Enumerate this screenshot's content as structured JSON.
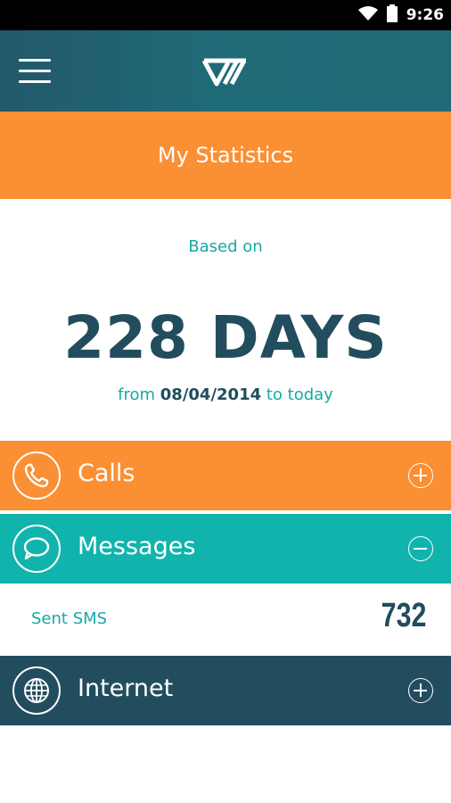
{
  "status_bar": {
    "time": "9:26",
    "icons": [
      "wifi-icon",
      "battery-icon"
    ]
  },
  "app_bar": {
    "menu_icon": "hamburger-menu-icon",
    "logo_icon": "app-logo-icon"
  },
  "banner": {
    "title": "My Statistics"
  },
  "summary": {
    "based_on": "Based on",
    "days": "228 DAYS",
    "range_prefix": "from ",
    "range_date": "08/04/2014",
    "range_suffix": " to today"
  },
  "sections": {
    "calls": {
      "label": "Calls",
      "icon": "phone-icon",
      "toggle": "expand-plus-icon",
      "expanded": false
    },
    "messages": {
      "label": "Messages",
      "icon": "chat-bubble-icon",
      "toggle": "collapse-minus-icon",
      "expanded": true
    },
    "internet": {
      "label": "Internet",
      "icon": "globe-icon",
      "toggle": "expand-plus-icon",
      "expanded": false
    }
  },
  "messages_detail": {
    "sent_sms_label": "Sent SMS",
    "sent_sms_value": "732"
  },
  "colors": {
    "orange": "#fb8f33",
    "teal": "#11b4ad",
    "dark_teal": "#224d5e",
    "text_teal": "#16a9a3"
  }
}
